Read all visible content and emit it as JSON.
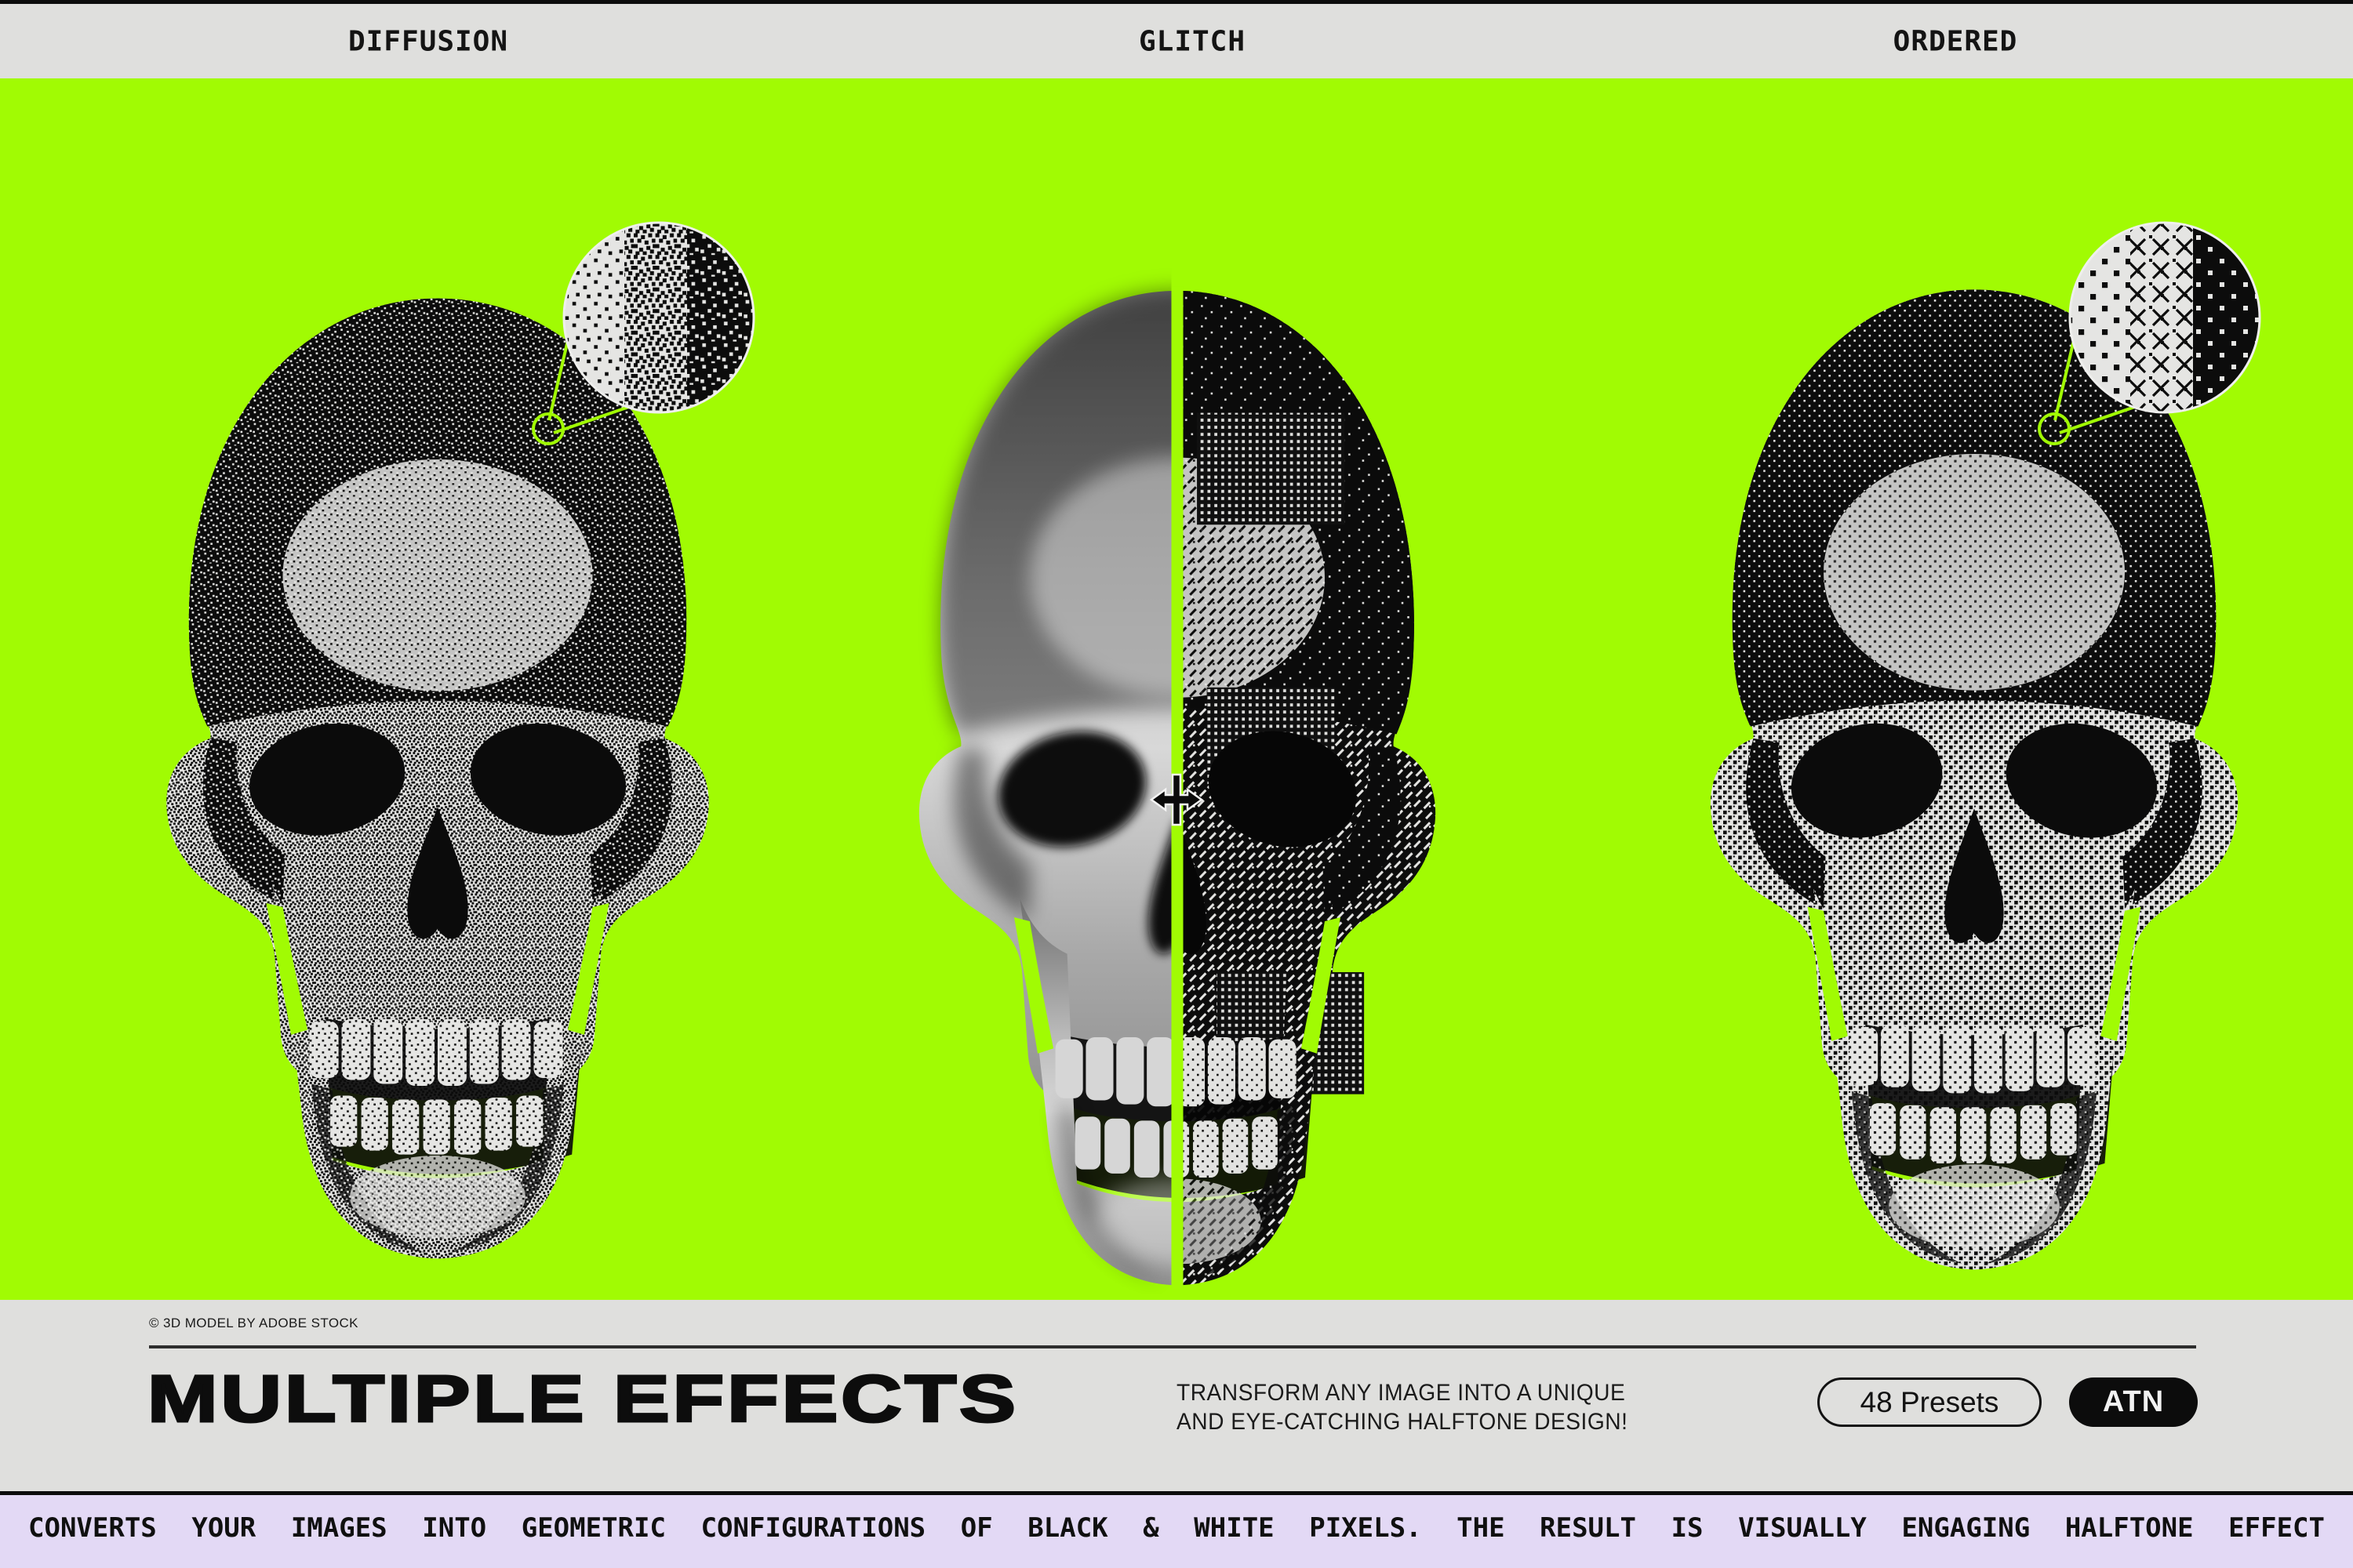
{
  "colors": {
    "accent_green": "#A1FB03",
    "panel_gray": "#DFDFDD",
    "ticker_lavender": "#E3D9F5",
    "ink": "#0D0D0D"
  },
  "header": {
    "labels": [
      {
        "id": "diffusion",
        "label": "DIFFUSION"
      },
      {
        "id": "glitch",
        "label": "GLITCH"
      },
      {
        "id": "ordered",
        "label": "ORDERED"
      }
    ]
  },
  "stage": {
    "skulls": [
      {
        "effect": "diffusion",
        "description": "diffusion-dither-skull"
      },
      {
        "effect": "glitch",
        "description": "split-original-vs-glitch-skull"
      },
      {
        "effect": "ordered",
        "description": "ordered-dither-skull"
      }
    ]
  },
  "footer": {
    "credit": "© 3D MODEL BY ADOBE STOCK",
    "title": "MULTIPLE EFFECTS",
    "subtitle_line1": "TRANSFORM ANY IMAGE INTO A UNIQUE",
    "subtitle_line2": "AND EYE-CATCHING HALFTONE DESIGN!",
    "presets_button": "48 Presets",
    "atn_button": "ATN"
  },
  "ticker": {
    "text": "CONVERTS YOUR IMAGES INTO GEOMETRIC CONFIGURATIONS OF BLACK & WHITE PIXELS. THE RESULT IS VISUALLY ENGAGING HALFTONE EFFECT"
  }
}
